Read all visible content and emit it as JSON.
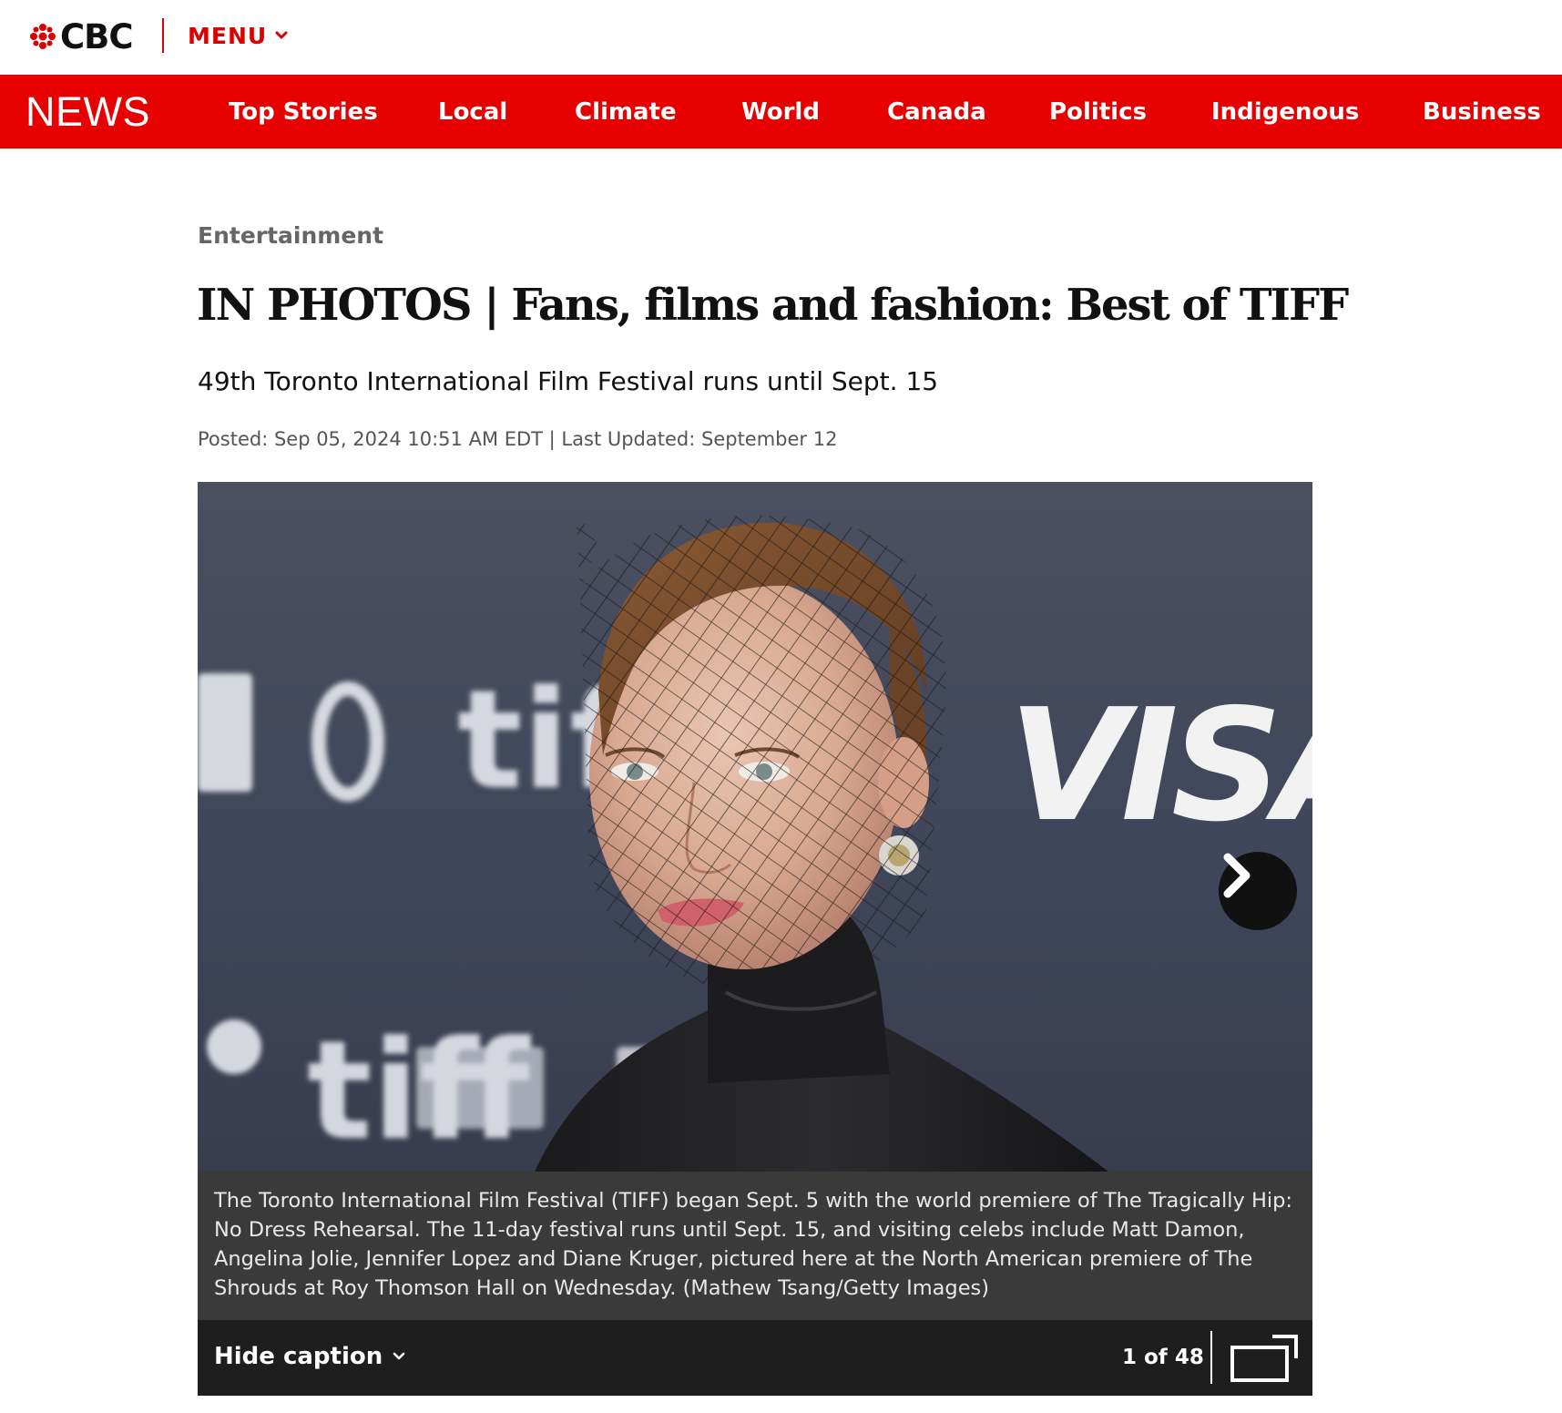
{
  "header": {
    "logo_text": "CBC",
    "menu_label": "MENU"
  },
  "news_nav": {
    "logo_text": "NEWS",
    "items": [
      {
        "label": "Top Stories"
      },
      {
        "label": "Local"
      },
      {
        "label": "Climate"
      },
      {
        "label": "World"
      },
      {
        "label": "Canada"
      },
      {
        "label": "Politics"
      },
      {
        "label": "Indigenous"
      },
      {
        "label": "Business"
      }
    ]
  },
  "article": {
    "section": "Entertainment",
    "headline": "IN PHOTOS | Fans, films and fashion: Best of TIFF",
    "subhead": "49th Toronto International Film Festival runs until Sept. 15",
    "dateline": "Posted: Sep 05, 2024 10:51 AM EDT | Last Updated: September 12"
  },
  "gallery": {
    "backdrop_logos": [
      "tiff",
      "tiff",
      "VISA"
    ],
    "caption": "The Toronto International Film Festival (TIFF) began Sept. 5 with the world premiere of The Tragically Hip: No Dress Rehearsal. The 11-day festival runs until Sept. 15, and visiting celebs include Matt Damon, Angelina Jolie, Jennifer Lopez and Diane Kruger, pictured here at the North American premiere of The Shrouds at Roy Thomson Hall on Wednesday. (Mathew Tsang/Getty Images)",
    "hide_caption_label": "Hide caption",
    "counter": "1 of 48",
    "next_icon": "chevron-right-icon",
    "fullscreen_icon": "expand-icon"
  },
  "colors": {
    "brand_red": "#e60000",
    "text_dark": "#111111",
    "section_gray": "#666666",
    "caption_bg": "#3a3a3a",
    "caption_bar_bg": "#1e1e1e"
  }
}
